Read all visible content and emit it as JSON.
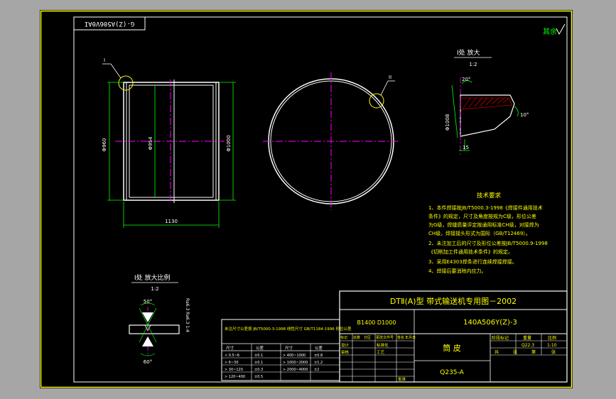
{
  "drawing": {
    "code_stamp": "G-(Z)A506V0AI",
    "roughness": "其余",
    "detail_view": {
      "title": "I处 放大",
      "scale": "1:2"
    },
    "weld_view": {
      "title": "I处 放大比例",
      "scale": "1:2"
    },
    "dims": {
      "length": "1130",
      "d_outer": "Φ960",
      "d_inner": "Φ954",
      "d_circle": "Φ1000",
      "angle_top": "20°",
      "angle_side": "10°",
      "dim_small": "15",
      "dim_side": "Φ1008",
      "angle_50": "50°",
      "angle_60": "60°",
      "label_I_left": "I",
      "label_I_right": "II",
      "weld_side": "Ra6.3 Ra6.3 1:4"
    },
    "tech": {
      "title": "技术要求",
      "lines": [
        "1、本件焊接按JB/T5000.3-1998《焊接件通用技术",
        "   条件》的规定，尺寸及角度按规为C级，形位公差",
        "   为G级，焊缝质量评定按通用标准CH级，对接焊为",
        "   CH级，焊接接头形式为国际（GB/T12469）。",
        "2、未注加工后的尺寸及形位公差按JB/T5000.9-1998",
        "   《切削加工件通用技术条件》的规定。",
        "3、采用E4303焊条进行连续焊接焊接。",
        "4、焊接后要消除内应力。"
      ]
    },
    "title_block": {
      "header": "DTⅡ(A)型 带式输送机专用图－2002",
      "spec": "B1400 D1000",
      "drawing_no": "140A506Y(Z)-3",
      "part_name": "筒 皮",
      "material": "Q235-A",
      "row_labels": [
        "标记",
        "处数",
        "分区",
        "更改文件号",
        "签名",
        "年月日"
      ],
      "sign_labels": [
        "设计",
        "标准化",
        "审核",
        "工艺",
        "批准"
      ],
      "right_header": [
        "阶段标记",
        "重量",
        "比例"
      ],
      "weight": "Q22.3",
      "scale": "1:10",
      "sheet": [
        "共",
        "张",
        "第",
        "张"
      ]
    },
    "tolerance_table": {
      "note": "未注尺寸公差按 JB/T5000.3-1998 线性尺寸 GB/T1184-1996 形位公差",
      "headers": [
        "尺寸",
        "公差",
        "尺寸",
        "公差"
      ],
      "rows": [
        [
          "< 0.5~6",
          "±0.1",
          "> 400~1000",
          "±0.8"
        ],
        [
          "> 6~30",
          "±0.1",
          "> 1000~2000",
          "±1.2"
        ],
        [
          "> 30~120",
          "±0.3",
          "> 2000~4000",
          "±2"
        ],
        [
          "> 120~400",
          "±0.5",
          "",
          ""
        ]
      ]
    }
  }
}
